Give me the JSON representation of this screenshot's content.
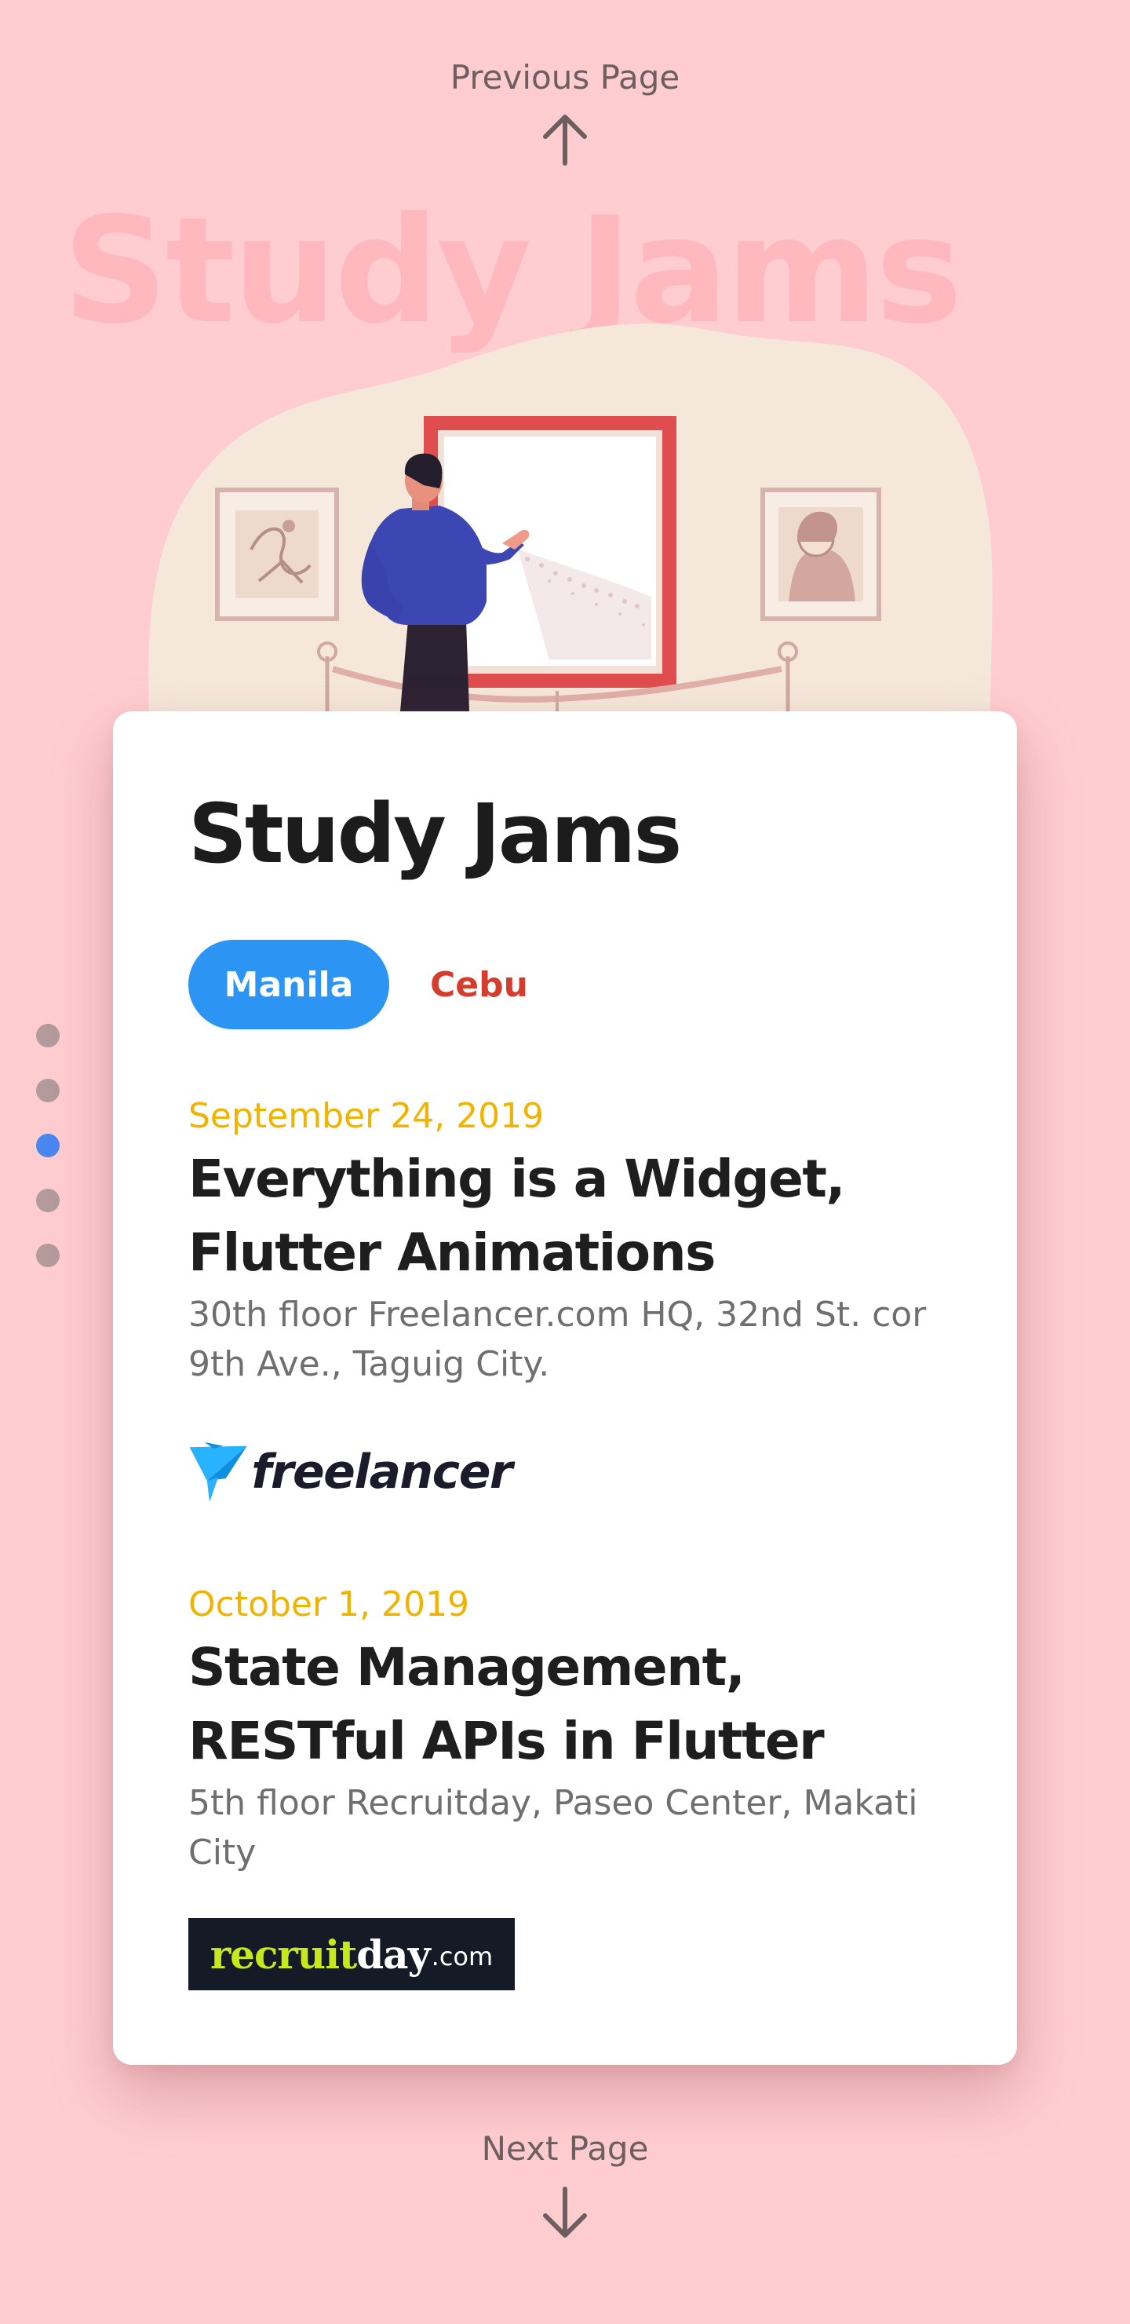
{
  "navigation": {
    "previous_label": "Previous Page",
    "next_label": "Next Page"
  },
  "background_title": "Study Jams",
  "page_indicator": {
    "count": 5,
    "active_index": 2
  },
  "card": {
    "title": "Study Jams",
    "tabs": [
      {
        "label": "Manila",
        "active": true
      },
      {
        "label": "Cebu",
        "active": false
      }
    ],
    "events": [
      {
        "date": "September 24, 2019",
        "title": "Everything is a Widget, Flutter Animations",
        "venue": "30th floor Freelancer.com HQ, 32nd St. cor 9th Ave., Taguig City.",
        "sponsor_logo": "freelancer"
      },
      {
        "date": "October 1, 2019",
        "title": "State Management, RESTful APIs in Flutter",
        "venue": "5th floor Recruitday, Paseo Center, Makati City",
        "sponsor_logo": {
          "part_1": "recruit",
          "part_2": "day",
          "part_3": ".com"
        }
      }
    ]
  },
  "colors": {
    "background": "#ffcdd0",
    "background_title": "#ffb8bd",
    "tab_active": "#2c95f4",
    "tab_inactive_text": "#d43d2e",
    "date": "#f0b400",
    "dot_active": "#4a86f0",
    "dot_inactive": "#b39a9c"
  },
  "icons": {
    "previous": "arrow-up-icon",
    "next": "arrow-down-icon"
  }
}
